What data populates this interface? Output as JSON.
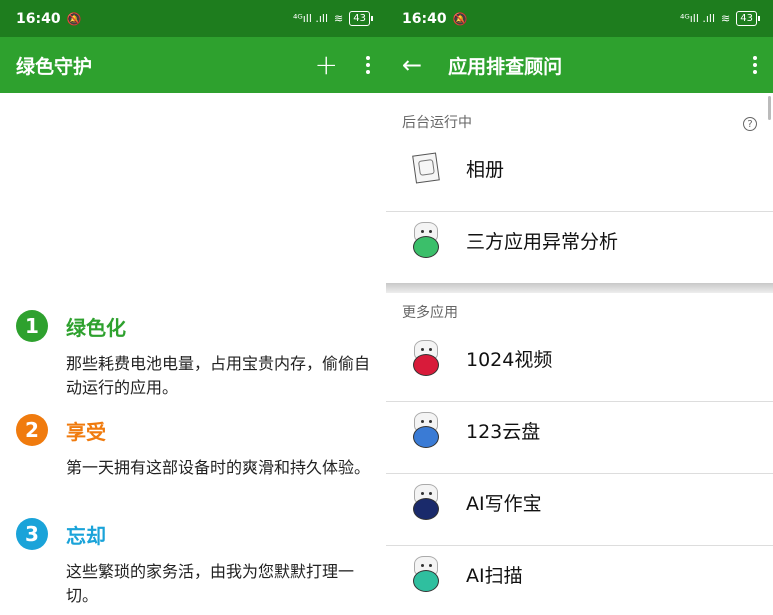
{
  "status": {
    "time": "16:40",
    "mute_icon": "mute-icon",
    "signal": "⁴ᴳıll .ıll",
    "battery": "43"
  },
  "left": {
    "title": "绿色守护",
    "features": [
      {
        "num": "1",
        "title": "绿色化",
        "desc": "那些耗费电池电量，占用宝贵内存，偷偷自动运行的应用。",
        "color": "#2ea12e"
      },
      {
        "num": "2",
        "title": "享受",
        "desc": "第一天拥有这部设备时的爽滑和持久体验。",
        "color": "#f07b0e"
      },
      {
        "num": "3",
        "title": "忘却",
        "desc": "这些繁琐的家务活，由我为您默默打理一切。",
        "color": "#1aa3d9"
      }
    ]
  },
  "right": {
    "title": "应用排查顾问",
    "running_label": "后台运行中",
    "help_icon": "?",
    "running": [
      {
        "name": "相册",
        "icon": "gallery-icon"
      },
      {
        "name": "三方应用异常分析",
        "icon": "cat-icon",
        "color": "#3bbf6a"
      }
    ],
    "more_label": "更多应用",
    "more": [
      {
        "name": "1024视频",
        "icon": "cat-icon",
        "color": "#d81b3a"
      },
      {
        "name": "123云盘",
        "icon": "cat-icon",
        "color": "#3a7bd5"
      },
      {
        "name": "AI写作宝",
        "icon": "cat-icon",
        "color": "#1a2a6b"
      },
      {
        "name": "AI扫描",
        "icon": "cat-icon",
        "color": "#2fbf9f"
      }
    ]
  }
}
